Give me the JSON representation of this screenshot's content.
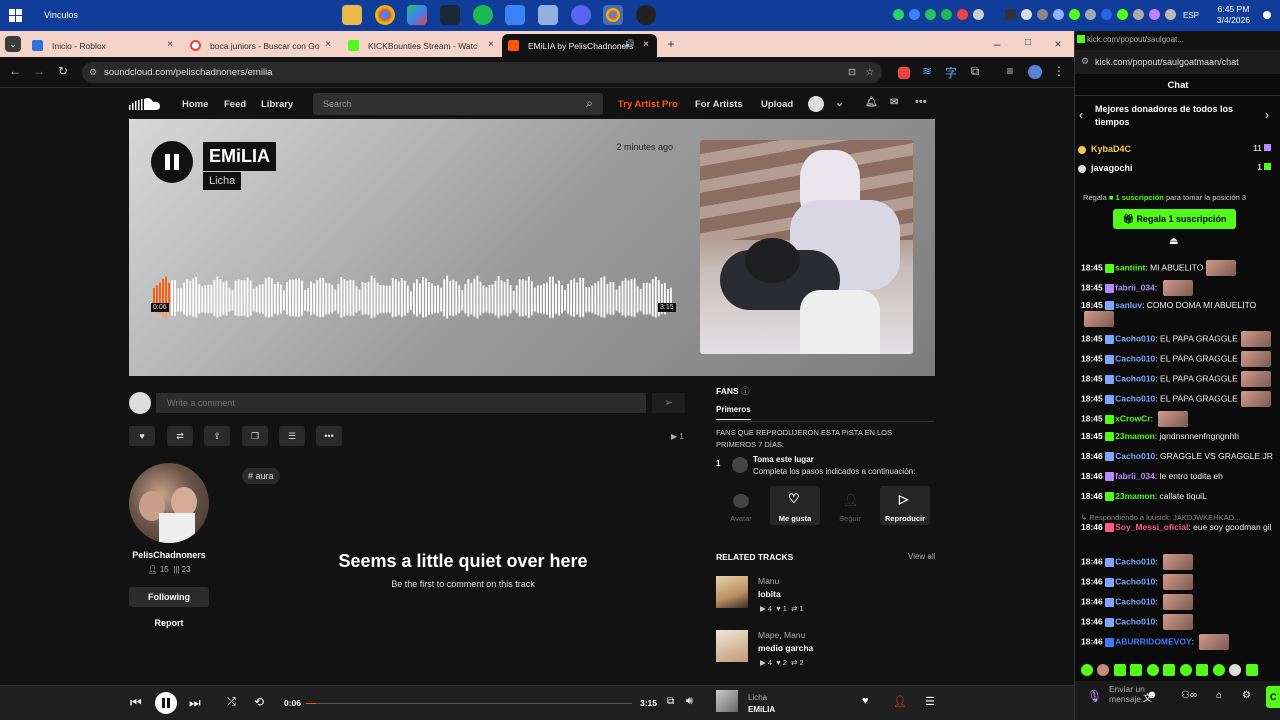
{
  "taskbar": {
    "title": "Vinculos",
    "time": "6:45 PM",
    "date": "3/4/2026",
    "lang": "ESP"
  },
  "browser": {
    "tabs": [
      {
        "label": "Inicio - Roblox",
        "color": "#2f6fde"
      },
      {
        "label": "boca juniors - Buscar con Goog",
        "color": "#ea4335"
      },
      {
        "label": "KICKBounties Stream - Watch L",
        "color": "#53fc18"
      },
      {
        "label": "EMiLIA by PelisChadnoners",
        "color": "#ff5500"
      }
    ],
    "url": "soundcloud.com/pelischadnoners/emilia"
  },
  "soundcloud": {
    "nav": {
      "home": "Home",
      "feed": "Feed",
      "library": "Library",
      "search_placeholder": "Search",
      "try_pro": "Try Artist Pro",
      "for_artists": "For Artists",
      "upload": "Upload"
    },
    "track": {
      "title": "EMiLIA",
      "artist": "Licha",
      "posted": "2 minutes ago",
      "current_time": "0:06",
      "duration": "3:15",
      "progress": 0.031
    },
    "comment_placeholder": "Write a comment",
    "plays": "1",
    "uploader": {
      "name": "PelisChadnoners",
      "followers": "15",
      "tracks": "23",
      "follow_label": "Following",
      "report_label": "Report"
    },
    "tag": "# aura",
    "empty": {
      "title": "Seems a little quiet over here",
      "subtitle": "Be the first to comment on this track"
    },
    "fans": {
      "title": "FANS",
      "tab": "Primeros",
      "desc": "FANS QUE REPRODUJERON ESTA PISTA EN LOS PRIMEROS 7 DÍAS:",
      "rank": "1",
      "line1": "Toma este lugar",
      "line2": "Completa los pasos indicados a continuación:",
      "buttons": [
        "Avatar",
        "Me gusta",
        "Seguir",
        "Reproducir"
      ]
    },
    "related": {
      "title": "RELATED TRACKS",
      "view_all": "View all",
      "items": [
        {
          "artist": "Manu",
          "title": "lobita",
          "plays": "4",
          "likes": "1",
          "reposts": "1"
        },
        {
          "artist": "Mape, Manu",
          "title": "medio garcha",
          "plays": "4",
          "likes": "2",
          "reposts": "2"
        }
      ]
    },
    "player": {
      "artist": "Licha",
      "title": "EMiLIA"
    }
  },
  "chat": {
    "url_bar": "kick.com/popout/saulgoat...",
    "url": "kick.com/popout/saulgoatmaan/chat",
    "title": "Chat",
    "donors_title": "Mejores donadores de todos los tiempos",
    "donors": [
      {
        "name": "KybaD4C",
        "count": "11",
        "color": "#f7c948"
      },
      {
        "name": "javagochi",
        "count": "1",
        "color": "#ffffff"
      }
    ],
    "gift_text_pre": "Regala",
    "gift_text_strong": "1 suscripción",
    "gift_text_post": "para tomar la posición 3",
    "gift_button": "Regala 1 suscripción",
    "messages": [
      {
        "time": "18:45",
        "user": "santiint",
        "color": "#53fc18",
        "text": "MI ABUELITO",
        "emote": true
      },
      {
        "time": "18:45",
        "user": "fabrii_034",
        "color": "#b78bff",
        "text": "",
        "emote": true
      },
      {
        "time": "18:45",
        "user": "sanluv",
        "color": "#7aa7ff",
        "text": "COMO DOMA MI ABUELITO",
        "emote": true
      },
      {
        "time": "18:45",
        "user": "Cacho010",
        "color": "#7aa7ff",
        "text": "EL PAPA GRAGGLE",
        "emote": true
      },
      {
        "time": "18:45",
        "user": "Cacho010",
        "color": "#7aa7ff",
        "text": "EL PAPA GRAGGLE",
        "emote": true
      },
      {
        "time": "18:45",
        "user": "Cacho010",
        "color": "#7aa7ff",
        "text": "EL PAPA GRAGGLE",
        "emote": true
      },
      {
        "time": "18:45",
        "user": "Cacho010",
        "color": "#7aa7ff",
        "text": "EL PAPA GRAGGLE",
        "emote": true
      },
      {
        "time": "18:45",
        "user": "xCrowCr",
        "color": "#53fc18",
        "text": "",
        "emote": true
      },
      {
        "time": "18:45",
        "user": "23mamon",
        "color": "#53fc18",
        "text": "jqndnsnnenfngngnhh",
        "emote": false
      },
      {
        "time": "18:46",
        "user": "Cacho010",
        "color": "#7aa7ff",
        "text": "GRAGGLE VS GRAGGLE JR",
        "emote": false
      },
      {
        "time": "18:46",
        "user": "fabrii_034",
        "color": "#b78bff",
        "text": "le entro todita eh",
        "emote": false
      },
      {
        "time": "18:46",
        "user": "23mamon",
        "color": "#53fc18",
        "text": "callate tiquiL",
        "emote": false
      },
      {
        "time": "18:46",
        "user": "Soy_Messi_oficial",
        "color": "#ff5c8a",
        "text": "eue soy goodman gil",
        "emote": false
      },
      {
        "time": "18:46",
        "user": "Cacho010",
        "color": "#7aa7ff",
        "text": "",
        "emote": true
      },
      {
        "time": "18:46",
        "user": "Cacho010",
        "color": "#7aa7ff",
        "text": "",
        "emote": true
      },
      {
        "time": "18:46",
        "user": "Cacho010",
        "color": "#7aa7ff",
        "text": "",
        "emote": true
      },
      {
        "time": "18:46",
        "user": "Cacho010",
        "color": "#7aa7ff",
        "text": "",
        "emote": true
      },
      {
        "time": "18:46",
        "user": "ABURRIDOMEVOY",
        "color": "#3d7bff",
        "text": "",
        "emote": true
      }
    ],
    "reply_note": "Respondiendo a luusick: JAKDJWKEHKAD...",
    "input_placeholder": "Enviar un mensaje",
    "send_label": "C"
  }
}
